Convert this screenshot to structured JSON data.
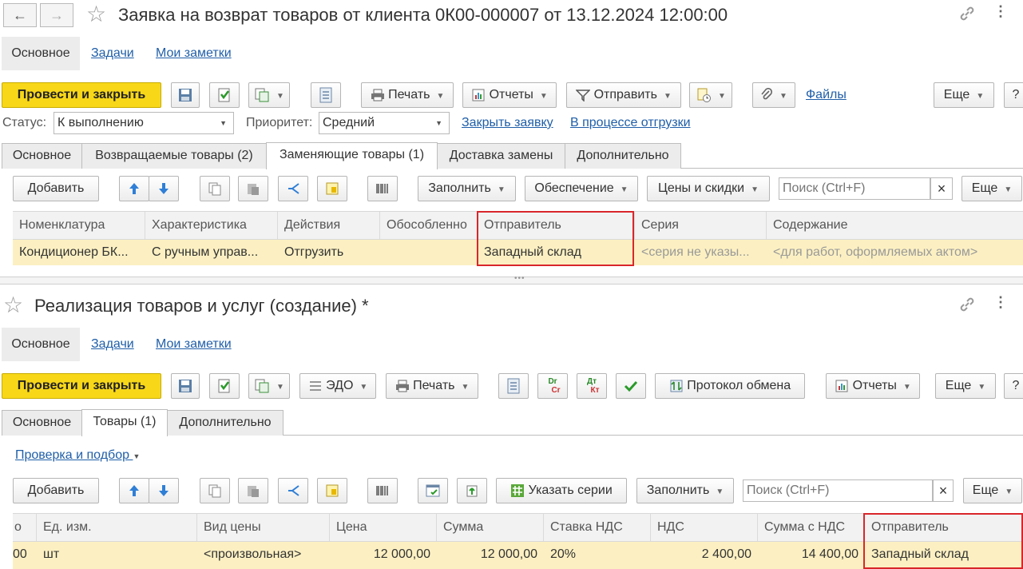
{
  "top": {
    "title": "Заявка на возврат товаров от клиента 0К00-000007 от 13.12.2024 12:00:00",
    "nav_back": "←",
    "nav_forward": "→",
    "section_tabs": [
      "Основное",
      "Задачи",
      "Мои заметки"
    ],
    "toolbar": {
      "post_close": "Провести и закрыть",
      "print": "Печать",
      "reports": "Отчеты",
      "send": "Отправить",
      "files": "Файлы",
      "more": "Еще"
    },
    "status_label": "Статус:",
    "status_value": "К выполнению",
    "priority_label": "Приоритет:",
    "priority_value": "Средний",
    "close_request": "Закрыть заявку",
    "in_shipment": "В процессе отгрузки",
    "tabs": [
      "Основное",
      "Возвращаемые товары (2)",
      "Заменяющие товары (1)",
      "Доставка замены",
      "Дополнительно"
    ],
    "table_toolbar": {
      "add": "Добавить",
      "fill": "Заполнить",
      "supply": "Обеспечение",
      "prices": "Цены и скидки",
      "search_placeholder": "Поиск (Ctrl+F)",
      "clear": "×",
      "more": "Еще"
    },
    "columns": [
      "Номенклатура",
      "Характеристика",
      "Действия",
      "Обособленно",
      "Отправитель",
      "Серия",
      "Содержание"
    ],
    "row": [
      "Кондиционер БК...",
      "С ручным управ...",
      "Отгрузить",
      "",
      "Западный склад",
      "<серия не указы...",
      "<для работ, оформляемых актом>"
    ]
  },
  "splitter": "•••",
  "bottom": {
    "title": "Реализация товаров и услуг (создание) *",
    "section_tabs": [
      "Основное",
      "Задачи",
      "Мои заметки"
    ],
    "toolbar": {
      "post_close": "Провести и закрыть",
      "edo": "ЭДО",
      "print": "Печать",
      "dr": "Dr",
      "cr": "Cr",
      "dt": "Дт",
      "kt": "Кт",
      "exchange_protocol": "Протокол обмена",
      "reports": "Отчеты",
      "more": "Еще"
    },
    "tabs": [
      "Основное",
      "Товары (1)",
      "Дополнительно"
    ],
    "check_selection": "Проверка и подбор",
    "table_toolbar": {
      "add": "Добавить",
      "specify_series": "Указать серии",
      "fill": "Заполнить",
      "search_placeholder": "Поиск (Ctrl+F)",
      "clear": "×",
      "more": "Еще"
    },
    "columns": [
      "о",
      "Ед. изм.",
      "Вид цены",
      "Цена",
      "Сумма",
      "Ставка НДС",
      "НДС",
      "Сумма с НДС",
      "Отправитель"
    ],
    "row": [
      "00",
      "шт",
      "<произвольная>",
      "12 000,00",
      "12 000,00",
      "20%",
      "2 400,00",
      "14 400,00",
      "Западный склад"
    ]
  },
  "colors": {
    "accent_yellow": "#f7d718",
    "link_blue": "#1f5ea8",
    "row_highlight": "#fcf0c2",
    "annotation_red": "#d9262b"
  }
}
